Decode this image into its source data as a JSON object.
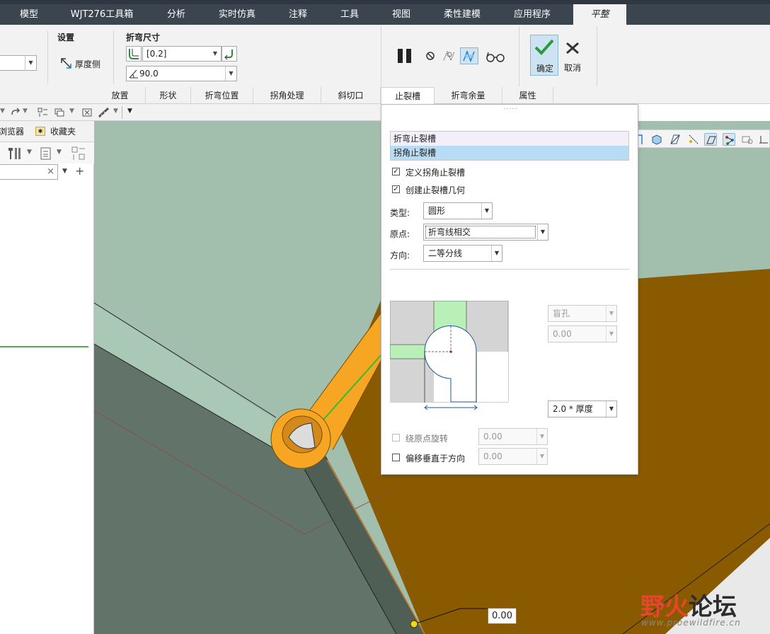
{
  "menu": {
    "tabs": [
      "模型",
      "WJT276工具箱",
      "分析",
      "实时仿真",
      "注释",
      "工具",
      "视图",
      "柔性建模",
      "应用程序",
      "平整"
    ]
  },
  "ribbon": {
    "settings_label": "设置",
    "thickness_side": "厚度侧",
    "bend_size_label": "折弯尺寸",
    "radius_value": "[0.2]",
    "angle_value": "90.0",
    "ok_label": "确定",
    "cancel_label": "取消",
    "subtabs": [
      "放置",
      "形状",
      "折弯位置",
      "拐角处理",
      "斜切口",
      "止裂槽",
      "折弯余量",
      "属性"
    ],
    "active_subtab": "止裂槽"
  },
  "navigator": {
    "browser_tab": "浏览器",
    "favorites_tab": "收藏夹"
  },
  "relief_panel": {
    "list_items": [
      "折弯止裂槽",
      "拐角止裂槽"
    ],
    "selected_item": "拐角止裂槽",
    "define_corner_relief": "定义拐角止裂槽",
    "create_relief_geometry": "创建止裂槽几何",
    "type_label": "类型:",
    "type_value": "圆形",
    "origin_label": "原点:",
    "origin_value": "折弯线相交",
    "direction_label": "方向:",
    "direction_value": "二等分线",
    "depth_type": "盲孔",
    "depth_value": "0.00",
    "dimension_value": "2.0 * 厚度",
    "rotate_about_origin": "绕原点旋转",
    "rotate_value": "0.00",
    "offset_perpendicular": "偏移垂直于方向",
    "offset_value": "0.00"
  },
  "canvas": {
    "dimension_label": "0.00"
  },
  "watermark": {
    "name": "野火论坛",
    "url": "www.proewildfire.cn"
  },
  "colors": {
    "menubar": "#3b4550",
    "part_green": "#a2bfae",
    "part_dark": "#627469",
    "flange_brown": "#8a5a00",
    "bend_orange": "#f6a623",
    "accent_blue": "#b7dcf5"
  }
}
